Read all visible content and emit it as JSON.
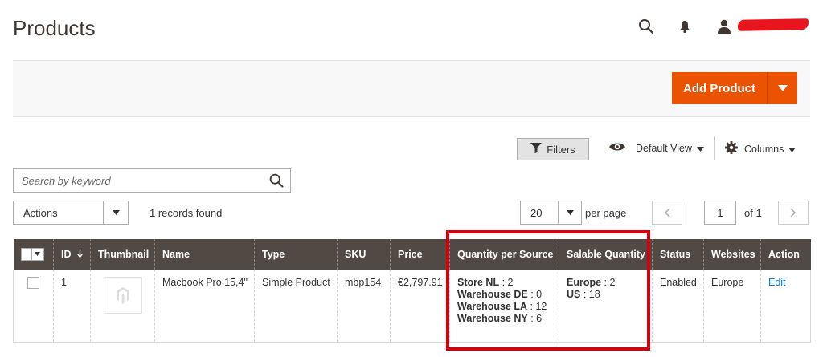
{
  "header": {
    "title": "Products"
  },
  "actions_bar": {
    "add_product_label": "Add Product"
  },
  "toolbar": {
    "filters_label": "Filters",
    "view_label": "Default View",
    "columns_label": "Columns",
    "search_placeholder": "Search by keyword",
    "mass_actions_label": "Actions",
    "records_found": "1 records found",
    "per_page_value": "20",
    "per_page_label": "per page",
    "current_page": "1",
    "of_pages": "of 1"
  },
  "grid": {
    "columns": [
      "ID",
      "Thumbnail",
      "Name",
      "Type",
      "SKU",
      "Price",
      "Quantity per Source",
      "Salable Quantity",
      "Status",
      "Websites",
      "Action"
    ],
    "rows": [
      {
        "id": "1",
        "name": "Macbook Pro 15,4\"",
        "type": "Simple Product",
        "sku": "mbp154",
        "price": "€2,797.91",
        "sources": [
          {
            "name": "Store NL",
            "qty": " : 2"
          },
          {
            "name": "Warehouse DE",
            "qty": " : 0"
          },
          {
            "name": "Warehouse LA",
            "qty": " : 12"
          },
          {
            "name": "Warehouse NY",
            "qty": " : 6"
          }
        ],
        "salable": [
          {
            "name": "Europe",
            "qty": " : 2"
          },
          {
            "name": "US",
            "qty": " : 18"
          }
        ],
        "status": "Enabled",
        "websites": "Europe",
        "action": "Edit"
      }
    ]
  },
  "colors": {
    "accent": "#eb5202",
    "header_bg": "#514943",
    "highlight": "#d9000d",
    "link": "#007bdb"
  },
  "icons": [
    "search-icon",
    "bell-icon",
    "user-icon",
    "chevron-down-icon",
    "filter-icon",
    "eye-icon",
    "gear-icon",
    "sort-down-arrow-icon",
    "magento-placeholder-icon",
    "chevron-left-icon",
    "chevron-right-icon"
  ]
}
